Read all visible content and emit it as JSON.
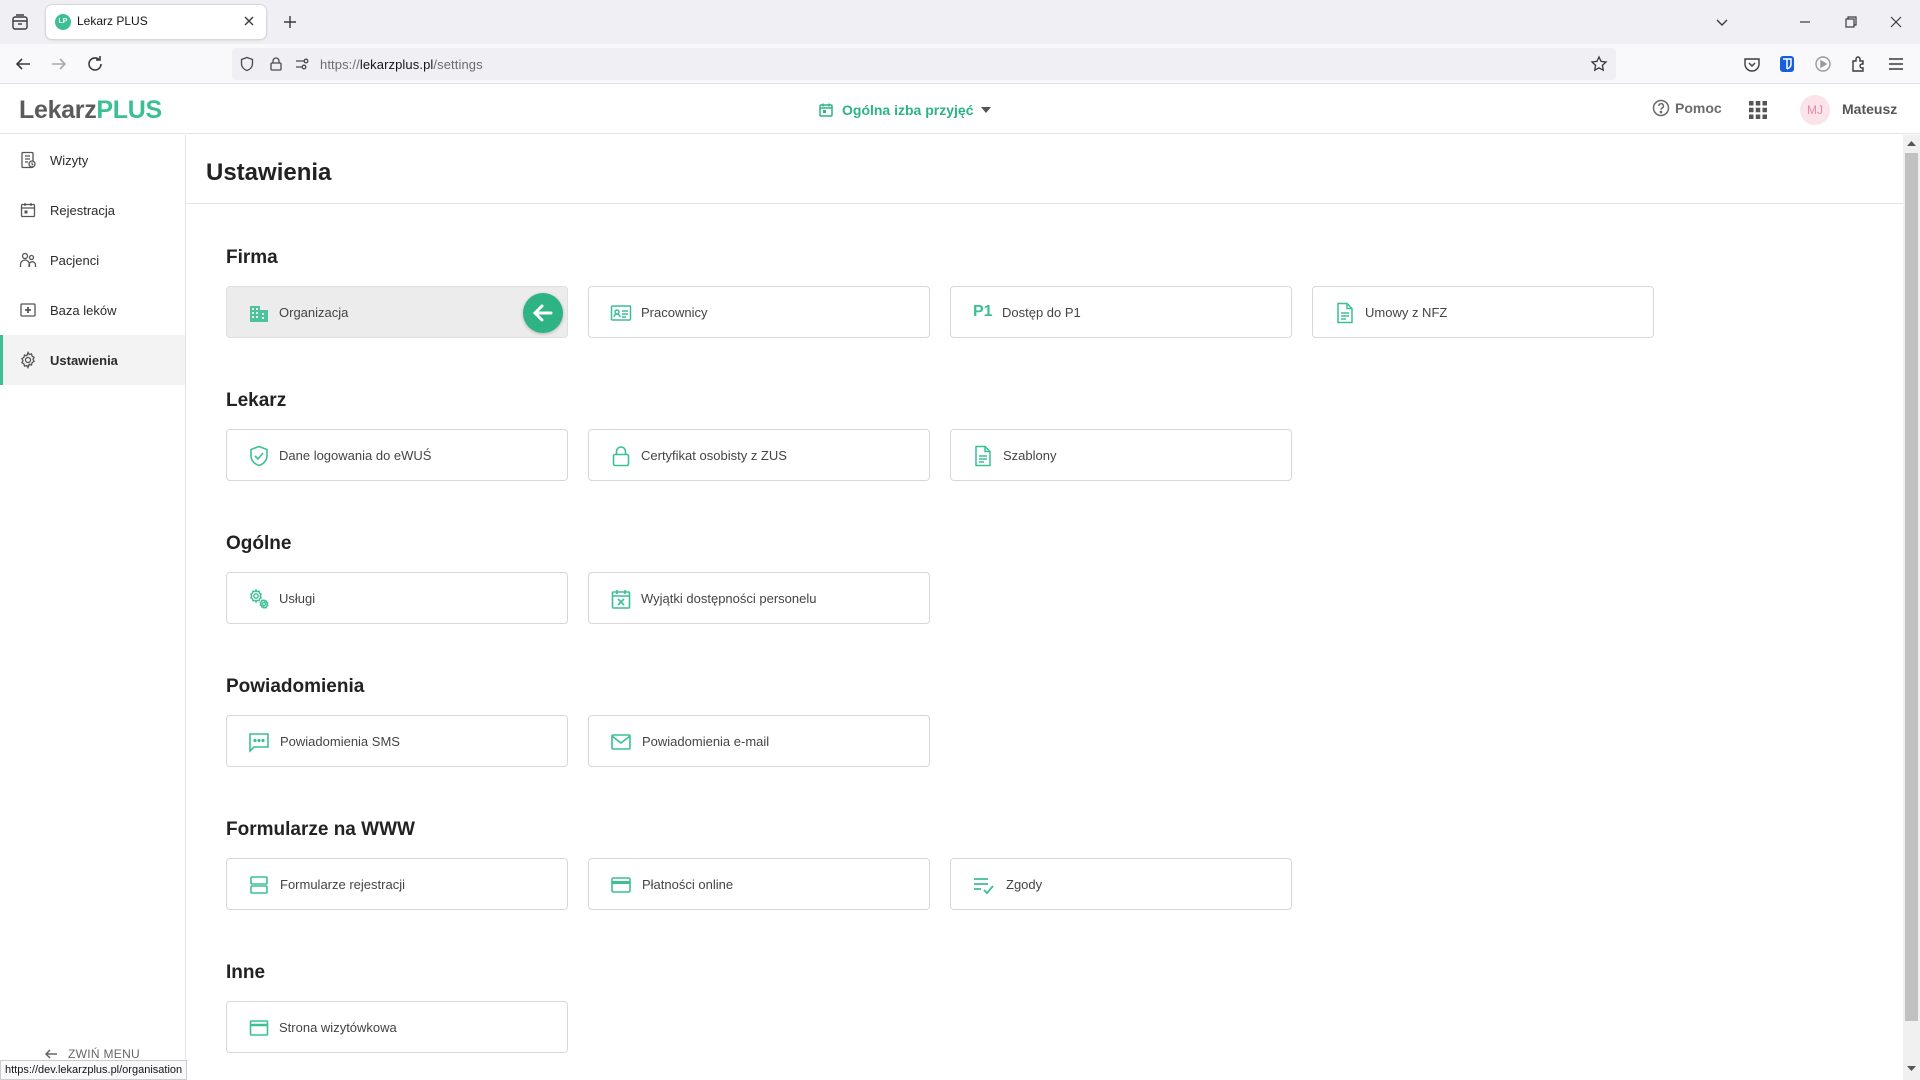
{
  "browser": {
    "tab_title": "Lekarz PLUS",
    "tab_favicon_text": "LP",
    "url_prefix": "https://",
    "url_domain": "lekarzplus.pl",
    "url_path": "/settings",
    "status_url": "https://dev.lekarzplus.pl/organisation"
  },
  "header": {
    "logo_part1": "Lekarz",
    "logo_part2": "PLUS",
    "ward": "Ogólna izba przyjęć",
    "help": "Pomoc",
    "avatar_initials": "MJ",
    "user_name": "Mateusz"
  },
  "sidebar": {
    "items": [
      {
        "label": "Wizyty",
        "icon": "visits-icon"
      },
      {
        "label": "Rejestracja",
        "icon": "calendar-icon"
      },
      {
        "label": "Pacjenci",
        "icon": "patients-icon"
      },
      {
        "label": "Baza leków",
        "icon": "medicine-icon"
      },
      {
        "label": "Ustawienia",
        "icon": "gear-icon",
        "active": true
      }
    ],
    "collapse_label": "ZWIŃ MENU"
  },
  "main": {
    "title": "Ustawienia",
    "sections": [
      {
        "title": "Firma",
        "cards": [
          {
            "label": "Organizacja",
            "icon": "building-icon",
            "selected": true
          },
          {
            "label": "Pracownicy",
            "icon": "id-card-icon"
          },
          {
            "label": "Dostęp do P1",
            "icon": "P1"
          },
          {
            "label": "Umowy z NFZ",
            "icon": "document-icon"
          }
        ]
      },
      {
        "title": "Lekarz",
        "cards": [
          {
            "label": "Dane logowania do eWUŚ",
            "icon": "shield-check-icon"
          },
          {
            "label": "Certyfikat osobisty z ZUS",
            "icon": "lock-icon"
          },
          {
            "label": "Szablony",
            "icon": "template-icon"
          }
        ]
      },
      {
        "title": "Ogólne",
        "cards": [
          {
            "label": "Usługi",
            "icon": "gears-icon"
          },
          {
            "label": "Wyjątki dostępności personelu",
            "icon": "calendar-x-icon"
          }
        ]
      },
      {
        "title": "Powiadomienia",
        "cards": [
          {
            "label": "Powiadomienia SMS",
            "icon": "sms-icon"
          },
          {
            "label": "Powiadomienia e-mail",
            "icon": "mail-icon"
          }
        ]
      },
      {
        "title": "Formularze na WWW",
        "cards": [
          {
            "label": "Formularze rejestracji",
            "icon": "form-icon"
          },
          {
            "label": "Płatności online",
            "icon": "credit-card-icon"
          },
          {
            "label": "Zgody",
            "icon": "checklist-icon"
          }
        ]
      },
      {
        "title": "Inne",
        "cards": [
          {
            "label": "Strona wizytówkowa",
            "icon": "browser-window-icon"
          }
        ]
      }
    ]
  },
  "colors": {
    "accent": "#3cbf95",
    "accent_dark": "#2db384",
    "text": "#222222",
    "selected_card_bg": "#ececec"
  }
}
